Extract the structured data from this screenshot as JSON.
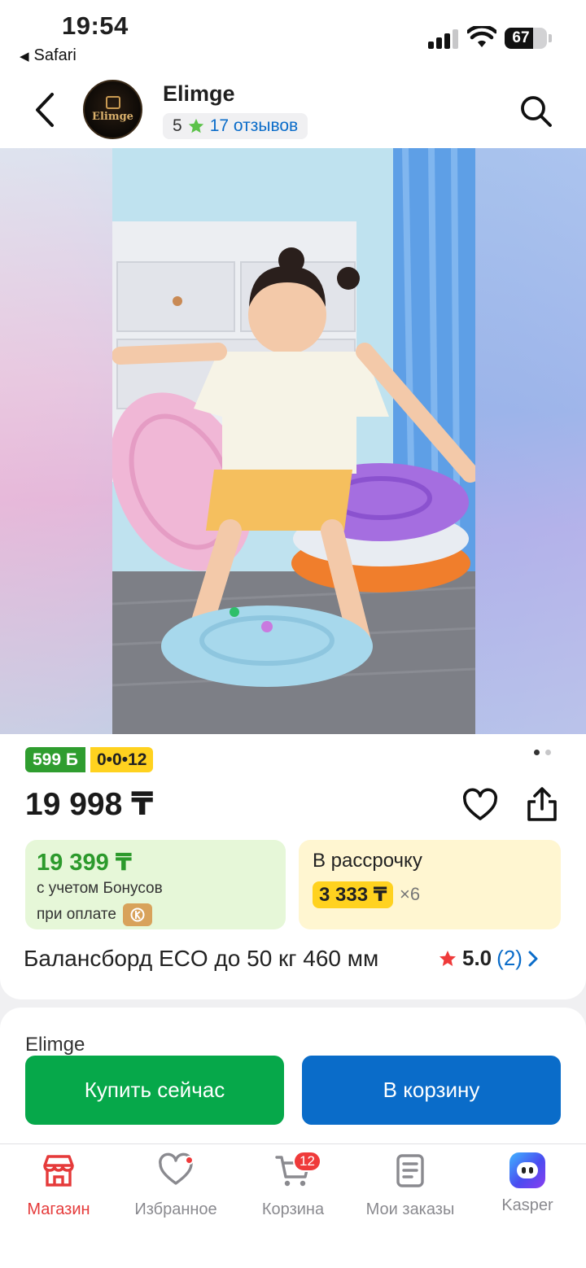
{
  "status_bar": {
    "time": "19:54",
    "back_app": "Safari",
    "battery": "67",
    "battery_level": 0.67
  },
  "header": {
    "shop_name": "Elimge",
    "logo_text": "Elimge",
    "rating": "5",
    "reviews": "17 отзывов"
  },
  "gallery": {
    "image_alt": "child standing on balance board",
    "dots_total": 2,
    "dots_active": 1
  },
  "product": {
    "bonus_badge": "599 Б",
    "installment_badge": "0•0•12",
    "price": "19 998 ₸",
    "bonus_card": {
      "price": "19 399 ₸",
      "line1": "с учетом Бонусов",
      "line2": "при оплате"
    },
    "installment_card": {
      "title": "В рассрочку",
      "amount": "3 333 ₸",
      "multiplier": "×6"
    },
    "title": "Балансборд ECO до 50 кг 460 мм",
    "rating": "5.0",
    "rating_count": "(2)"
  },
  "seller_section": {
    "peek_text": "Elimge"
  },
  "actions": {
    "buy_now": "Купить сейчас",
    "add_to_cart": "В корзину"
  },
  "tabbar": {
    "items": [
      {
        "label": "Магазин",
        "icon": "shop-icon"
      },
      {
        "label": "Избранное",
        "icon": "heart-icon"
      },
      {
        "label": "Корзина",
        "icon": "cart-icon"
      },
      {
        "label": "Мои заказы",
        "icon": "orders-icon"
      },
      {
        "label": "Kasper",
        "icon": "kasper-icon"
      }
    ],
    "cart_count": "12"
  },
  "colors": {
    "accent_blue": "#0a6cc9",
    "buy_green": "#06a84a",
    "active_red": "#e53a3a",
    "bonus_green": "#2c9a2c",
    "yellow": "#ffd21f"
  }
}
